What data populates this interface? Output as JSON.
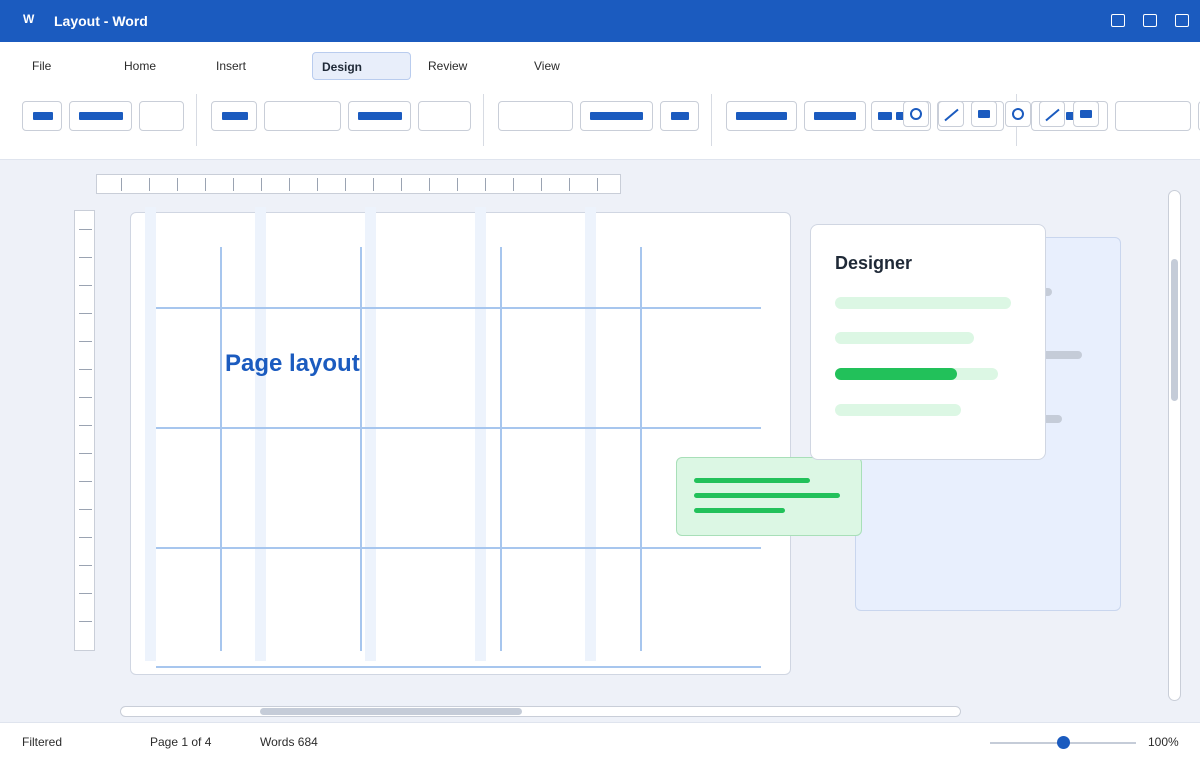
{
  "window": {
    "app_logo": "W",
    "title": "Layout - Word"
  },
  "ribbon": {
    "tabs": [
      "File",
      "Home",
      "Insert",
      "Design",
      "Review",
      "View"
    ],
    "active_tab": "Design"
  },
  "document": {
    "heading": "Page layout"
  },
  "designer_panel": {
    "title": "Designer",
    "highlighted_option_level": 0.75
  },
  "status": {
    "filter": "Filtered",
    "page": "Page 1 of 4",
    "words": "Words 684",
    "zoom": "100%",
    "zoom_level": 0.5
  },
  "colors": {
    "accent": "#1b5bbf",
    "success": "#22c15a",
    "success_light": "#dcf7e4",
    "grid": "#a7c6ee"
  }
}
